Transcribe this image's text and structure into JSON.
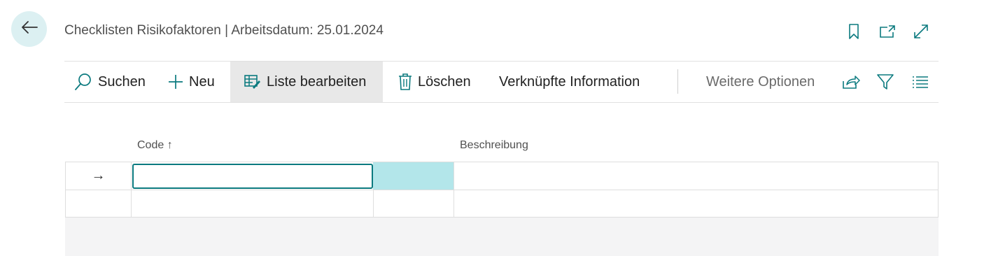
{
  "header": {
    "title": "Checklisten Risikofaktoren | Arbeitsdatum: 25.01.2024",
    "icons": [
      "back-arrow-icon",
      "bookmark-icon",
      "open-new-window-icon",
      "expand-icon"
    ]
  },
  "actions": {
    "search": "Suchen",
    "new": "Neu",
    "edit_list": "Liste bearbeiten",
    "delete": "Löschen",
    "related": "Verknüpfte Information",
    "more": "Weitere Optionen"
  },
  "table": {
    "columns": [
      {
        "label": "Code",
        "sort": "ascending",
        "sort_glyph": "↑"
      },
      {
        "label": "Beschreibung"
      }
    ],
    "rows": [
      {
        "indicator": "→",
        "code": "",
        "description": ""
      },
      {
        "indicator": "",
        "code": "",
        "description": ""
      }
    ]
  },
  "colors": {
    "accent": "#0b7a7f",
    "highlight": "#b3e6ea",
    "back_bg": "#dcf0f2"
  }
}
